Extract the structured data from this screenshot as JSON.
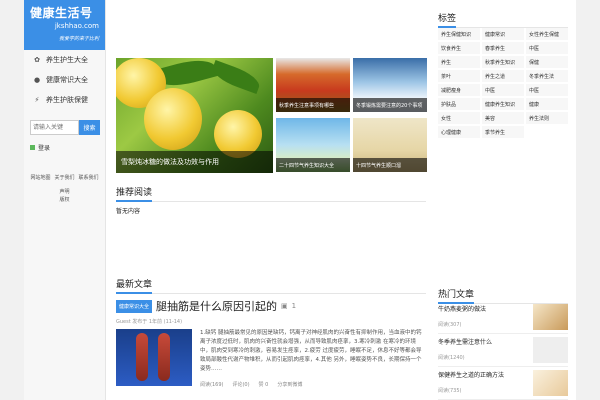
{
  "site": {
    "title": "健康生活号",
    "domain": "jkshhao.com",
    "slogan": "我爱学的来于比利"
  },
  "nav": [
    {
      "icon": "leaf-icon",
      "glyph": "✿",
      "label": "养生护生大全"
    },
    {
      "icon": "circle-icon",
      "glyph": "●",
      "label": "健康常识大全"
    },
    {
      "icon": "bolt-icon",
      "glyph": "⚡",
      "label": "养生护肤保健"
    }
  ],
  "search": {
    "placeholder": "请输入关键",
    "button": "搜索"
  },
  "login": {
    "label": "登录"
  },
  "footer": {
    "links": [
      "网站地图",
      "关于我们",
      "联系我们"
    ],
    "line1": "声明",
    "line2": "版权"
  },
  "slider": {
    "caption": "雪梨炖冰糖的做法及功效与作用"
  },
  "thumbs": [
    "秋季养生注意事项有哪些",
    "冬季锻炼需要注意的20个事项",
    "二十四节气养生知识大全",
    "十四节气养生顺口溜"
  ],
  "recommend": {
    "title": "推荐阅读",
    "text": "暂无内容"
  },
  "latest": {
    "title": "最新文章",
    "article": {
      "tag": "健康常识大全",
      "title": "腿抽筋是什么原因引起的",
      "photo_count": "1",
      "meta": "Guest 发布于 1年前 (11-14)",
      "text": "1.缺钙 腿抽筋最常见的原因是缺钙，钙离子对神经肌肉的兴奋性有抑制作用，当血液中的钙离子浓度过低时，肌肉的兴奋性就会增强，从而导致肌肉痉挛，3.寒冷刺激 在寒冷的环境中，肌肉受到寒冷的刺激，容易发生痉挛，2.疲劳 过度疲劳，睡眠不足，休息不好等都会导致局部酸性代谢产物堆积，从而引起肌肉痉挛，4.其他 另外，睡眠姿势不良，长期保持一个姿势……",
      "views": "阅读(169)",
      "comments": "评论(0)",
      "likes": "赞 0",
      "share": "分享到微博"
    }
  },
  "tags_section": {
    "title": "标签",
    "tags": [
      "养生保健知识",
      "健康常识",
      "女性养生保健",
      "饮食养生",
      "春季养生",
      "中医",
      "养生",
      "秋季养生知识",
      "保健",
      "茶叶",
      "养生之道",
      "冬季养生法",
      "减肥瘦身",
      "中医",
      "中医",
      "护肤品",
      "健康养生知识",
      "健康",
      "女性",
      "美容",
      "养生法则",
      "心理健康",
      "季节养生"
    ]
  },
  "hot": {
    "title": "热门文章",
    "items": [
      {
        "title": "牛奶燕麦粥的做法",
        "meta": "阅读(307)"
      },
      {
        "title": "冬季养生需注意什么",
        "meta": "阅读(1240)"
      },
      {
        "title": "保健养生之道的正确方法",
        "meta": "阅读(735)"
      }
    ]
  },
  "colors": {
    "accent": "#3b8fe6",
    "sidebar_bg": "#f7f7f7",
    "page_bg": "#f1f1f1"
  }
}
